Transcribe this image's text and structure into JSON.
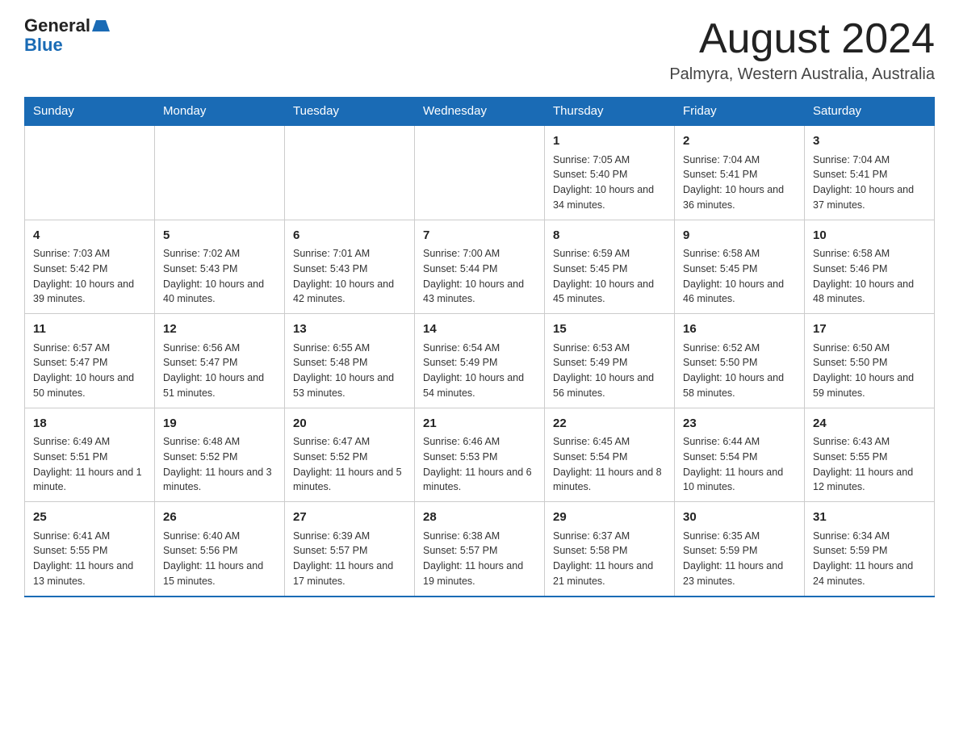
{
  "header": {
    "logo_general": "General",
    "logo_blue": "Blue",
    "month_title": "August 2024",
    "location": "Palmyra, Western Australia, Australia"
  },
  "days_of_week": [
    "Sunday",
    "Monday",
    "Tuesday",
    "Wednesday",
    "Thursday",
    "Friday",
    "Saturday"
  ],
  "weeks": [
    [
      {
        "day": "",
        "info": ""
      },
      {
        "day": "",
        "info": ""
      },
      {
        "day": "",
        "info": ""
      },
      {
        "day": "",
        "info": ""
      },
      {
        "day": "1",
        "info": "Sunrise: 7:05 AM\nSunset: 5:40 PM\nDaylight: 10 hours and 34 minutes."
      },
      {
        "day": "2",
        "info": "Sunrise: 7:04 AM\nSunset: 5:41 PM\nDaylight: 10 hours and 36 minutes."
      },
      {
        "day": "3",
        "info": "Sunrise: 7:04 AM\nSunset: 5:41 PM\nDaylight: 10 hours and 37 minutes."
      }
    ],
    [
      {
        "day": "4",
        "info": "Sunrise: 7:03 AM\nSunset: 5:42 PM\nDaylight: 10 hours and 39 minutes."
      },
      {
        "day": "5",
        "info": "Sunrise: 7:02 AM\nSunset: 5:43 PM\nDaylight: 10 hours and 40 minutes."
      },
      {
        "day": "6",
        "info": "Sunrise: 7:01 AM\nSunset: 5:43 PM\nDaylight: 10 hours and 42 minutes."
      },
      {
        "day": "7",
        "info": "Sunrise: 7:00 AM\nSunset: 5:44 PM\nDaylight: 10 hours and 43 minutes."
      },
      {
        "day": "8",
        "info": "Sunrise: 6:59 AM\nSunset: 5:45 PM\nDaylight: 10 hours and 45 minutes."
      },
      {
        "day": "9",
        "info": "Sunrise: 6:58 AM\nSunset: 5:45 PM\nDaylight: 10 hours and 46 minutes."
      },
      {
        "day": "10",
        "info": "Sunrise: 6:58 AM\nSunset: 5:46 PM\nDaylight: 10 hours and 48 minutes."
      }
    ],
    [
      {
        "day": "11",
        "info": "Sunrise: 6:57 AM\nSunset: 5:47 PM\nDaylight: 10 hours and 50 minutes."
      },
      {
        "day": "12",
        "info": "Sunrise: 6:56 AM\nSunset: 5:47 PM\nDaylight: 10 hours and 51 minutes."
      },
      {
        "day": "13",
        "info": "Sunrise: 6:55 AM\nSunset: 5:48 PM\nDaylight: 10 hours and 53 minutes."
      },
      {
        "day": "14",
        "info": "Sunrise: 6:54 AM\nSunset: 5:49 PM\nDaylight: 10 hours and 54 minutes."
      },
      {
        "day": "15",
        "info": "Sunrise: 6:53 AM\nSunset: 5:49 PM\nDaylight: 10 hours and 56 minutes."
      },
      {
        "day": "16",
        "info": "Sunrise: 6:52 AM\nSunset: 5:50 PM\nDaylight: 10 hours and 58 minutes."
      },
      {
        "day": "17",
        "info": "Sunrise: 6:50 AM\nSunset: 5:50 PM\nDaylight: 10 hours and 59 minutes."
      }
    ],
    [
      {
        "day": "18",
        "info": "Sunrise: 6:49 AM\nSunset: 5:51 PM\nDaylight: 11 hours and 1 minute."
      },
      {
        "day": "19",
        "info": "Sunrise: 6:48 AM\nSunset: 5:52 PM\nDaylight: 11 hours and 3 minutes."
      },
      {
        "day": "20",
        "info": "Sunrise: 6:47 AM\nSunset: 5:52 PM\nDaylight: 11 hours and 5 minutes."
      },
      {
        "day": "21",
        "info": "Sunrise: 6:46 AM\nSunset: 5:53 PM\nDaylight: 11 hours and 6 minutes."
      },
      {
        "day": "22",
        "info": "Sunrise: 6:45 AM\nSunset: 5:54 PM\nDaylight: 11 hours and 8 minutes."
      },
      {
        "day": "23",
        "info": "Sunrise: 6:44 AM\nSunset: 5:54 PM\nDaylight: 11 hours and 10 minutes."
      },
      {
        "day": "24",
        "info": "Sunrise: 6:43 AM\nSunset: 5:55 PM\nDaylight: 11 hours and 12 minutes."
      }
    ],
    [
      {
        "day": "25",
        "info": "Sunrise: 6:41 AM\nSunset: 5:55 PM\nDaylight: 11 hours and 13 minutes."
      },
      {
        "day": "26",
        "info": "Sunrise: 6:40 AM\nSunset: 5:56 PM\nDaylight: 11 hours and 15 minutes."
      },
      {
        "day": "27",
        "info": "Sunrise: 6:39 AM\nSunset: 5:57 PM\nDaylight: 11 hours and 17 minutes."
      },
      {
        "day": "28",
        "info": "Sunrise: 6:38 AM\nSunset: 5:57 PM\nDaylight: 11 hours and 19 minutes."
      },
      {
        "day": "29",
        "info": "Sunrise: 6:37 AM\nSunset: 5:58 PM\nDaylight: 11 hours and 21 minutes."
      },
      {
        "day": "30",
        "info": "Sunrise: 6:35 AM\nSunset: 5:59 PM\nDaylight: 11 hours and 23 minutes."
      },
      {
        "day": "31",
        "info": "Sunrise: 6:34 AM\nSunset: 5:59 PM\nDaylight: 11 hours and 24 minutes."
      }
    ]
  ]
}
